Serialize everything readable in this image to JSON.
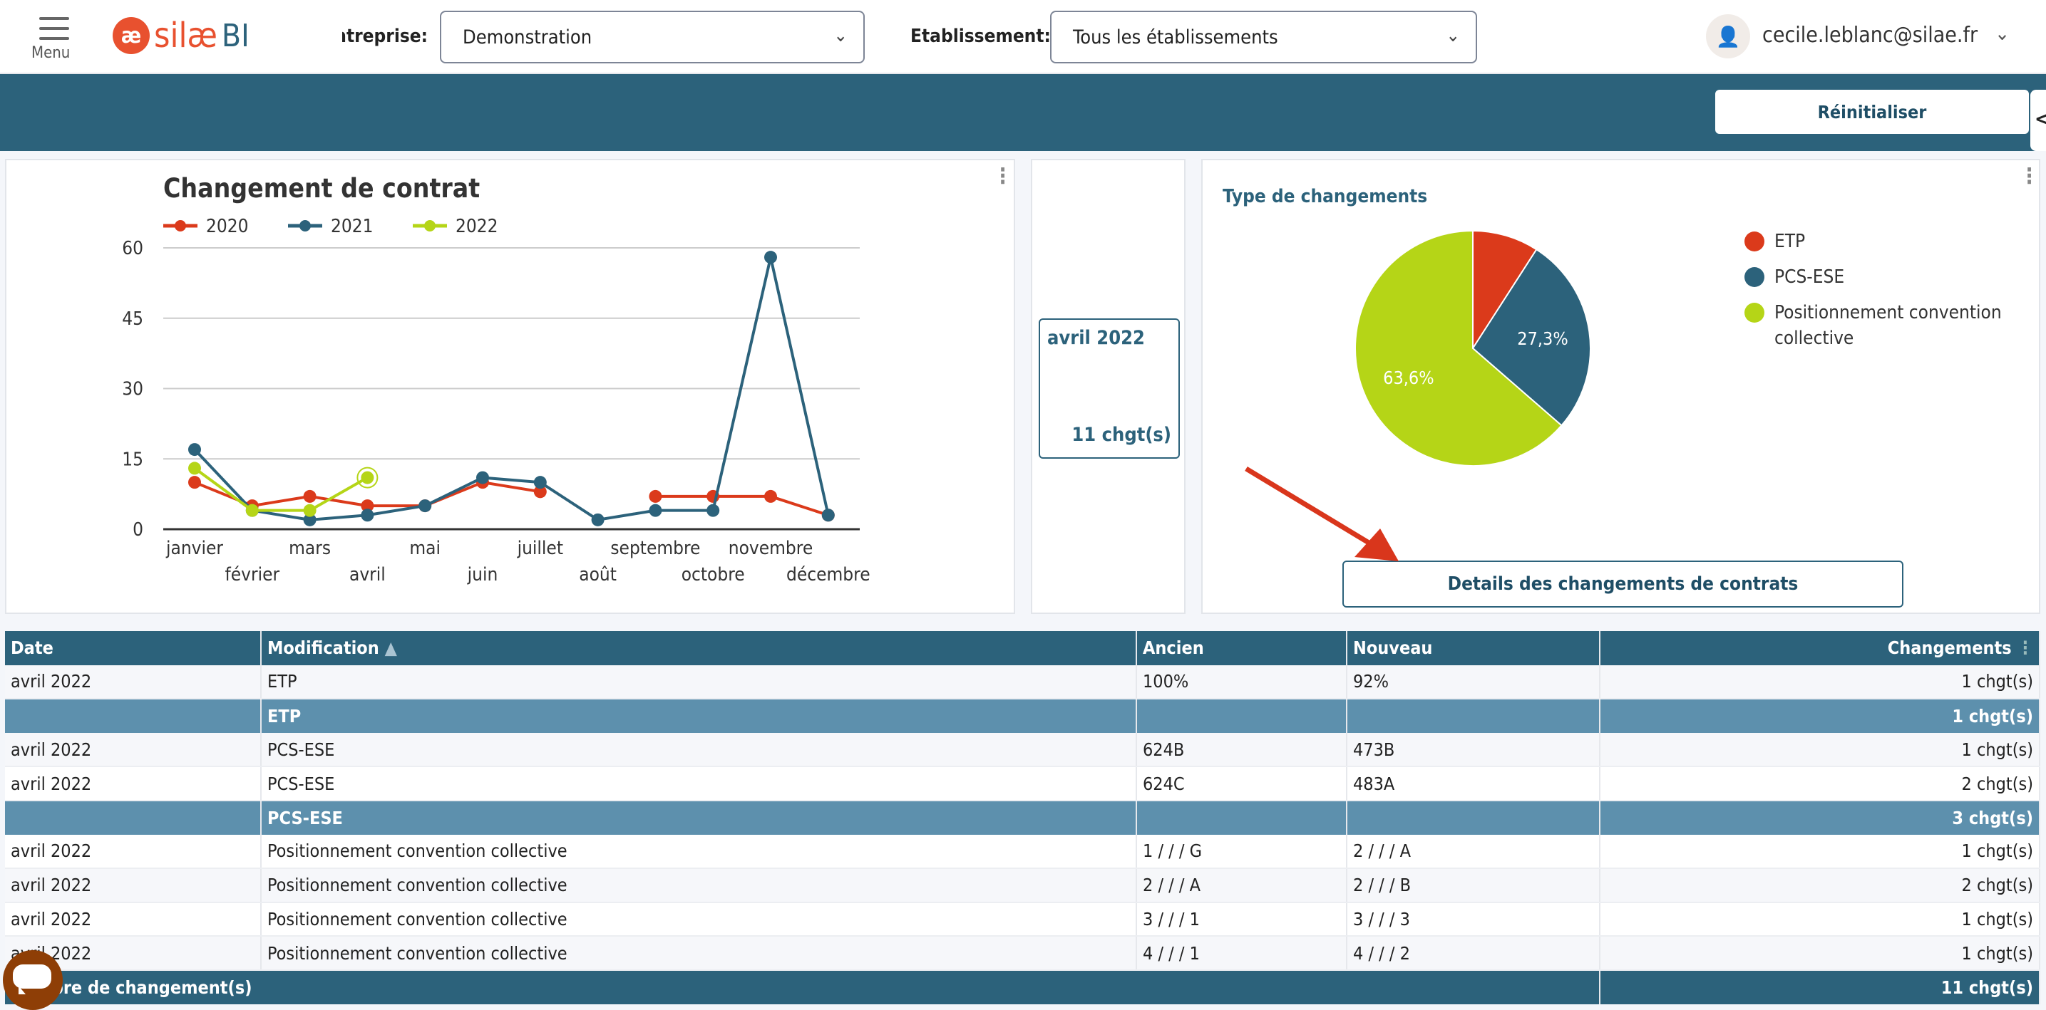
{
  "header": {
    "menu_label": "Menu",
    "logo_text": "silæ BI",
    "entreprise_label": "Entreprise:",
    "entreprise_value": "Demonstration",
    "etablissement_label": "Etablissement:",
    "etablissement_value": "Tous les établissements",
    "user_email": "cecile.leblanc@silae.fr"
  },
  "toolbar": {
    "reset_label": "Réinitialiser",
    "side_toggle": "<"
  },
  "chart_data": [
    {
      "type": "line",
      "title": "Changement de contrat",
      "categories": [
        "janvier",
        "février",
        "mars",
        "avril",
        "mai",
        "juin",
        "juillet",
        "août",
        "septembre",
        "octobre",
        "novembre",
        "décembre"
      ],
      "ylim": [
        0,
        60
      ],
      "yticks": [
        0,
        15,
        30,
        45,
        60
      ],
      "grid": true,
      "legend": "top-left",
      "series": [
        {
          "name": "2020",
          "color": "#db3a1b",
          "values": [
            10,
            5,
            7,
            5,
            5,
            10,
            8,
            null,
            7,
            7,
            7,
            3
          ]
        },
        {
          "name": "2021",
          "color": "#2c627b",
          "values": [
            17,
            4,
            2,
            3,
            5,
            11,
            10,
            2,
            4,
            4,
            58,
            3
          ]
        },
        {
          "name": "2022",
          "color": "#b5d517",
          "values": [
            13,
            4,
            4,
            11,
            null,
            null,
            null,
            null,
            null,
            null,
            null,
            null
          ]
        }
      ]
    },
    {
      "type": "pie",
      "title": "Type de changements",
      "legend": "right",
      "slices": [
        {
          "name": "ETP",
          "value": 9.1,
          "label": "",
          "color": "#db3a1b"
        },
        {
          "name": "PCS-ESE",
          "value": 27.3,
          "label": "27,3%",
          "color": "#2c627b"
        },
        {
          "name": "Positionnement convention collective",
          "value": 63.6,
          "label": "63,6%",
          "color": "#b5d517"
        }
      ]
    }
  ],
  "kpi": {
    "period": "avril 2022",
    "value": "11 chgt(s)"
  },
  "details_button": "Details des changements de contrats",
  "table": {
    "headers": [
      "Date",
      "Modification",
      "Ancien",
      "Nouveau",
      "Changements"
    ],
    "sort_indicator": "▲",
    "rows": [
      {
        "type": "r",
        "cells": [
          "avril 2022",
          "ETP",
          "100%",
          "92%",
          "1 chgt(s)"
        ]
      },
      {
        "type": "g",
        "cells": [
          "",
          "ETP",
          "",
          "",
          "1 chgt(s)"
        ]
      },
      {
        "type": "r",
        "cells": [
          "avril 2022",
          "PCS-ESE",
          "624B",
          "473B",
          "1 chgt(s)"
        ]
      },
      {
        "type": "r",
        "cells": [
          "avril 2022",
          "PCS-ESE",
          "624C",
          "483A",
          "2 chgt(s)"
        ]
      },
      {
        "type": "g",
        "cells": [
          "",
          "PCS-ESE",
          "",
          "",
          "3 chgt(s)"
        ]
      },
      {
        "type": "r",
        "cells": [
          "avril 2022",
          "Positionnement convention collective",
          "1 / / / G",
          "2 / / / A",
          "1 chgt(s)"
        ]
      },
      {
        "type": "r",
        "cells": [
          "avril 2022",
          "Positionnement convention collective",
          "2 / / / A",
          "2 / / / B",
          "2 chgt(s)"
        ]
      },
      {
        "type": "r",
        "cells": [
          "avril 2022",
          "Positionnement convention collective",
          "3 / / / 1",
          "3 / / / 3",
          "1 chgt(s)"
        ]
      },
      {
        "type": "r",
        "cells": [
          "avril 2022",
          "Positionnement convention collective",
          "4 / / / 1",
          "4 / / / 2",
          "1 chgt(s)"
        ]
      }
    ],
    "footer": {
      "label": "Nombre de changement(s)",
      "total": "11 chgt(s)"
    }
  }
}
